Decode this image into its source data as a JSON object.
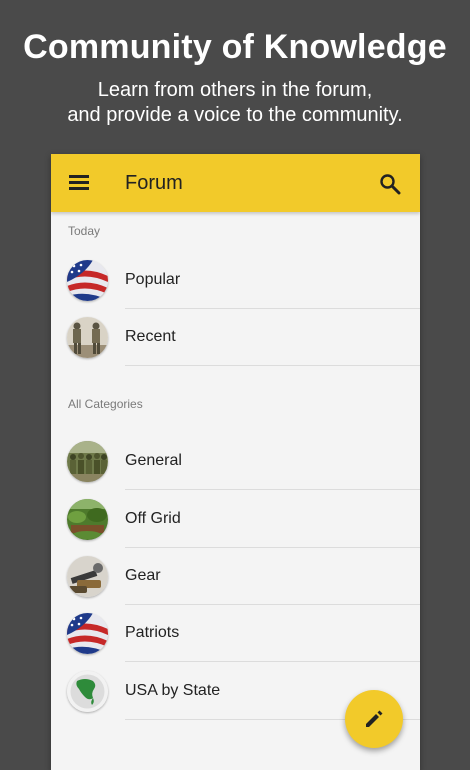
{
  "promo": {
    "title": "Community of Knowledge",
    "subtitle_line1": "Learn from others in the forum,",
    "subtitle_line2": "and provide a voice to the community."
  },
  "appbar": {
    "title": "Forum",
    "menu_icon": "menu-icon",
    "search_icon": "search-icon",
    "color": "#f2ca2a"
  },
  "sections": {
    "today": {
      "header": "Today",
      "items": [
        {
          "label": "Popular",
          "icon": "flag-avatar"
        },
        {
          "label": "Recent",
          "icon": "soldiers-avatar"
        }
      ]
    },
    "categories": {
      "header": "All Categories",
      "items": [
        {
          "label": "General",
          "icon": "crowd-avatar"
        },
        {
          "label": "Off Grid",
          "icon": "garden-avatar"
        },
        {
          "label": "Gear",
          "icon": "gear-avatar"
        },
        {
          "label": "Patriots",
          "icon": "flag-avatar"
        },
        {
          "label": "USA by State",
          "icon": "globe-avatar"
        }
      ]
    }
  },
  "fab": {
    "icon": "edit-icon"
  }
}
